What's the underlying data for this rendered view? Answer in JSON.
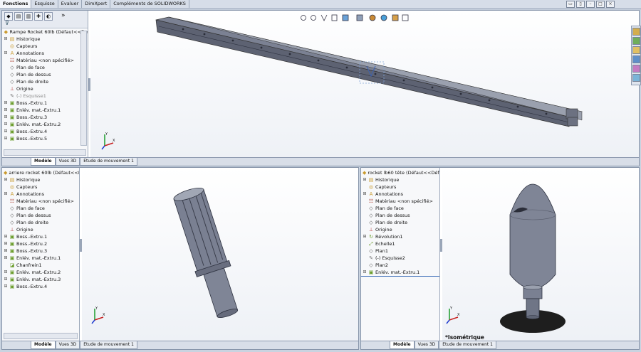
{
  "tabs": [
    "Fonctions",
    "Esquisse",
    "Evaluer",
    "DimXpert",
    "Compléments de SOLIDWORKS"
  ],
  "active_tab": 0,
  "top_pane": {
    "root": "Rampe Rocket 60lb  (Défaut<<De",
    "items": [
      {
        "label": "Historique",
        "icon": "folder",
        "exp": "+"
      },
      {
        "label": "Capteurs",
        "icon": "sensor",
        "exp": ""
      },
      {
        "label": "Annotations",
        "icon": "annot",
        "exp": "+"
      },
      {
        "label": "Matériau <non spécifié>",
        "icon": "material",
        "exp": ""
      },
      {
        "label": "Plan de face",
        "icon": "plane",
        "exp": ""
      },
      {
        "label": "Plan de dessus",
        "icon": "plane",
        "exp": ""
      },
      {
        "label": "Plan de droite",
        "icon": "plane",
        "exp": ""
      },
      {
        "label": "Origine",
        "icon": "origin",
        "exp": ""
      },
      {
        "label": "(-) Esquisse1",
        "icon": "sketch",
        "exp": "",
        "grey": true
      },
      {
        "label": "Boss.-Extru.1",
        "icon": "boss",
        "exp": "+"
      },
      {
        "label": "Enlév. mat.-Extru.1",
        "icon": "cut",
        "exp": "+"
      },
      {
        "label": "Boss.-Extru.3",
        "icon": "boss",
        "exp": "+"
      },
      {
        "label": "Enlév. mat.-Extru.2",
        "icon": "cut",
        "exp": "+"
      },
      {
        "label": "Boss.-Extru.4",
        "icon": "boss",
        "exp": "+"
      },
      {
        "label": "Boss.-Extru.5",
        "icon": "boss",
        "exp": "+"
      }
    ],
    "bottom_tabs": [
      "Modèle",
      "Vues 3D",
      "Etude de mouvement 1"
    ]
  },
  "left_pane": {
    "root": "arriere rocket 60lb  (Défaut<<Dé",
    "items": [
      {
        "label": "Historique",
        "icon": "folder",
        "exp": "+"
      },
      {
        "label": "Capteurs",
        "icon": "sensor",
        "exp": ""
      },
      {
        "label": "Annotations",
        "icon": "annot",
        "exp": "+"
      },
      {
        "label": "Matériau <non spécifié>",
        "icon": "material",
        "exp": ""
      },
      {
        "label": "Plan de face",
        "icon": "plane",
        "exp": ""
      },
      {
        "label": "Plan de dessus",
        "icon": "plane",
        "exp": ""
      },
      {
        "label": "Plan de droite",
        "icon": "plane",
        "exp": ""
      },
      {
        "label": "Origine",
        "icon": "origin",
        "exp": ""
      },
      {
        "label": "Boss.-Extru.1",
        "icon": "boss",
        "exp": "+"
      },
      {
        "label": "Boss.-Extru.2",
        "icon": "boss",
        "exp": "+"
      },
      {
        "label": "Boss.-Extru.3",
        "icon": "boss",
        "exp": "+"
      },
      {
        "label": "Enlév. mat.-Extru.1",
        "icon": "cut",
        "exp": "+"
      },
      {
        "label": "Chanfrein1",
        "icon": "chamfer",
        "exp": ""
      },
      {
        "label": "Enlév. mat.-Extru.2",
        "icon": "cut",
        "exp": "+"
      },
      {
        "label": "Enlév. mat.-Extru.3",
        "icon": "cut",
        "exp": "+"
      },
      {
        "label": "Boss.-Extru.4",
        "icon": "boss",
        "exp": "+"
      }
    ],
    "bottom_tabs": [
      "Modèle",
      "Vues 3D",
      "Etude de mouvement 1"
    ]
  },
  "right_pane": {
    "root": "rocket lb60 tête  (Défaut<<Défaut",
    "items": [
      {
        "label": "Historique",
        "icon": "folder",
        "exp": "+"
      },
      {
        "label": "Capteurs",
        "icon": "sensor",
        "exp": ""
      },
      {
        "label": "Annotations",
        "icon": "annot",
        "exp": "+"
      },
      {
        "label": "Matériau <non spécifié>",
        "icon": "material",
        "exp": ""
      },
      {
        "label": "Plan de face",
        "icon": "plane",
        "exp": ""
      },
      {
        "label": "Plan de dessus",
        "icon": "plane",
        "exp": ""
      },
      {
        "label": "Plan de droite",
        "icon": "plane",
        "exp": ""
      },
      {
        "label": "Origine",
        "icon": "origin",
        "exp": ""
      },
      {
        "label": "Révolution1",
        "icon": "revolve",
        "exp": "+"
      },
      {
        "label": "Echelle1",
        "icon": "scale",
        "exp": ""
      },
      {
        "label": "Plan1",
        "icon": "plane",
        "exp": ""
      },
      {
        "label": "(-) Esquisse2",
        "icon": "sketch",
        "exp": ""
      },
      {
        "label": "Plan2",
        "icon": "plane",
        "exp": ""
      },
      {
        "label": "Enlév. mat.-Extru.1",
        "icon": "cut",
        "exp": "+"
      }
    ],
    "bottom_tabs": [
      "Modèle",
      "Vues 3D",
      "Etude de mouvement 1"
    ],
    "view_label": "*Isométrique"
  },
  "colors": {
    "part": "#7f8596",
    "part_dark": "#5e6474",
    "part_light": "#a9afbd",
    "shadow": "#2a2a2a"
  }
}
